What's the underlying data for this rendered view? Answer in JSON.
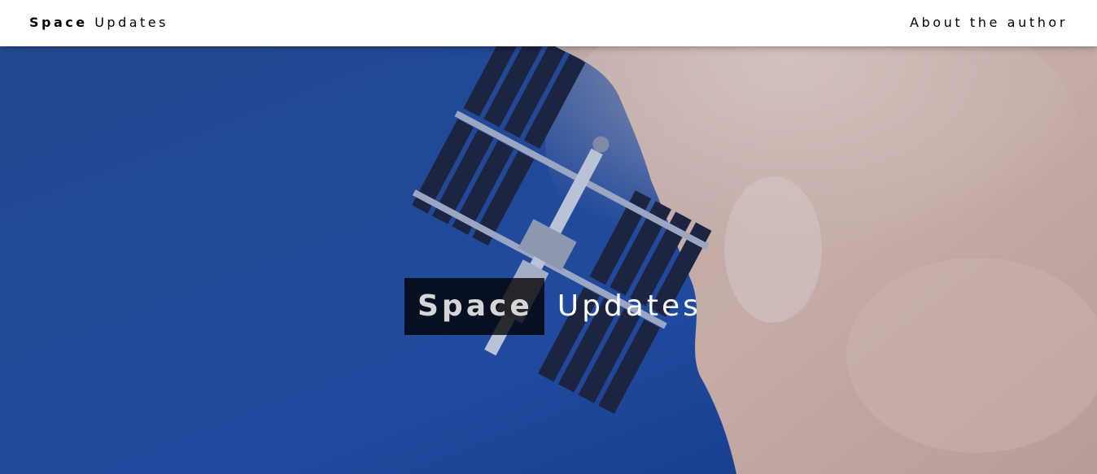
{
  "navbar": {
    "brand_bold": "Space",
    "brand_light": "Updates",
    "about_link": "About the author"
  },
  "hero": {
    "title_bold": "Space",
    "title_light": "Updates",
    "image": "space-station-over-earth"
  },
  "colors": {
    "ocean": "#1f4596",
    "land": "#c2a6a3",
    "solar_panel": "#1c2440",
    "overlay": "#000000"
  }
}
